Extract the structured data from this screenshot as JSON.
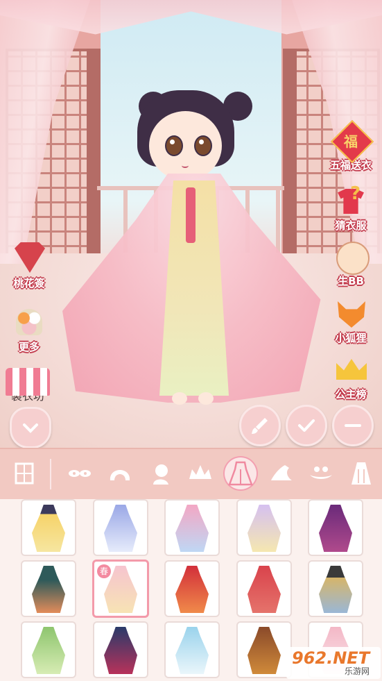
{
  "side_left": {
    "taohuaqian": "桃花簽",
    "more": "更多",
    "workshop": "製衣坊"
  },
  "side_right": {
    "wufu": "五福送衣",
    "fu_char": "福",
    "guess": "猜衣服",
    "baby": "生BB",
    "fox": "小狐狸",
    "princess": "公主榜"
  },
  "grid": {
    "selected_badge": "春"
  },
  "watermark": {
    "logo": "962.NET",
    "site": "乐游网"
  },
  "categories": [
    "wardrobe-icon",
    "eyes-icon",
    "hair-icon",
    "face-icon",
    "crown-icon",
    "dress-icon",
    "shoes-icon",
    "accessory-icon",
    "cloak-icon"
  ],
  "colors": {
    "accent": "#f39aaa",
    "label_outline": "#c23a4c"
  }
}
